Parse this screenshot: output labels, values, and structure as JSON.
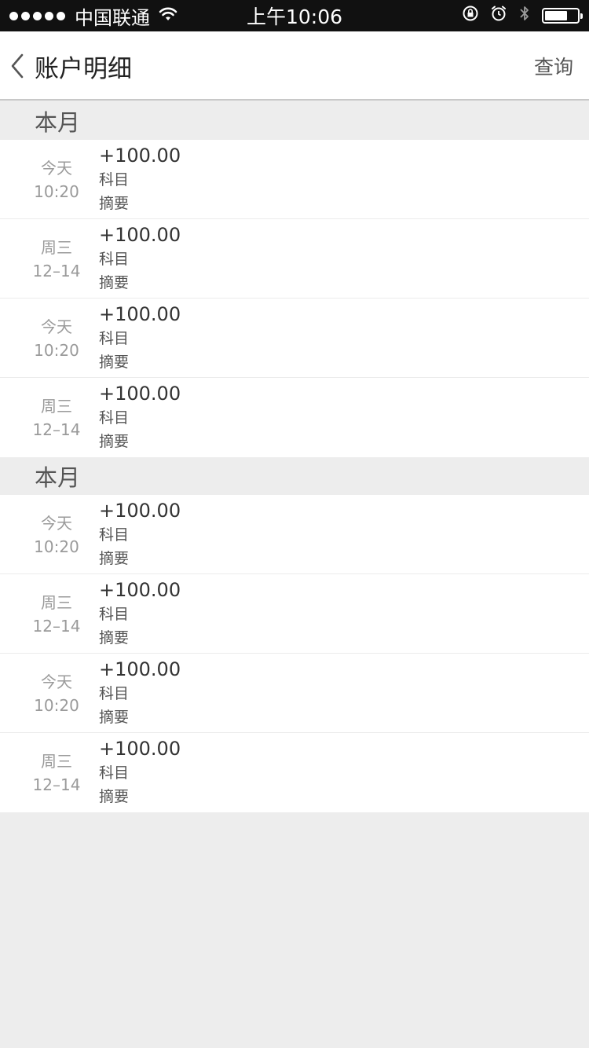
{
  "status_bar": {
    "carrier": "中国联通",
    "time": "上午10:06",
    "battery_level": 0.7
  },
  "nav": {
    "title": "账户明细",
    "action": "查询"
  },
  "sections": [
    {
      "title": "本月",
      "items": [
        {
          "day": "今天",
          "time": "10:20",
          "amount": "+100.00",
          "subject": "科目",
          "summary": "摘要"
        },
        {
          "day": "周三",
          "time": "12–14",
          "amount": "+100.00",
          "subject": "科目",
          "summary": "摘要"
        },
        {
          "day": "今天",
          "time": "10:20",
          "amount": "+100.00",
          "subject": "科目",
          "summary": "摘要"
        },
        {
          "day": "周三",
          "time": "12–14",
          "amount": "+100.00",
          "subject": "科目",
          "summary": "摘要"
        }
      ]
    },
    {
      "title": "本月",
      "items": [
        {
          "day": "今天",
          "time": "10:20",
          "amount": "+100.00",
          "subject": "科目",
          "summary": "摘要"
        },
        {
          "day": "周三",
          "time": "12–14",
          "amount": "+100.00",
          "subject": "科目",
          "summary": "摘要"
        },
        {
          "day": "今天",
          "time": "10:20",
          "amount": "+100.00",
          "subject": "科目",
          "summary": "摘要"
        },
        {
          "day": "周三",
          "time": "12–14",
          "amount": "+100.00",
          "subject": "科目",
          "summary": "摘要"
        }
      ]
    }
  ],
  "icons": {
    "wifi": "wifi-icon",
    "rotation_lock": "rotation-lock-icon",
    "alarm": "alarm-icon",
    "bluetooth": "bluetooth-icon",
    "battery": "battery-icon",
    "back": "chevron-left-icon"
  }
}
